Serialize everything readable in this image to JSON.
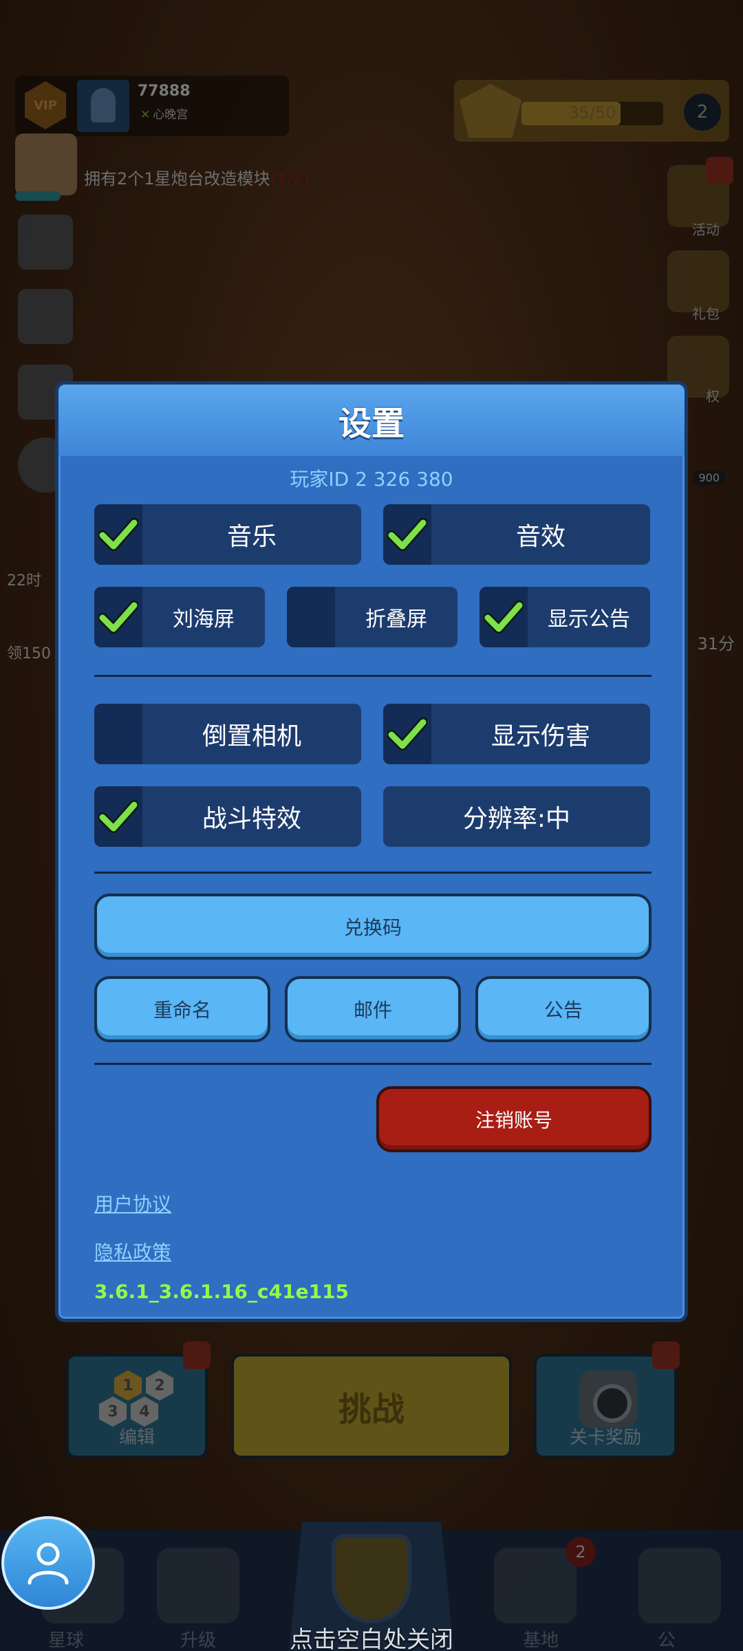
{
  "hud": {
    "vip_label": "VIP",
    "player_score": "77888",
    "player_rank": "心晚宫",
    "star_progress_text": "35/50",
    "star_progress_ratio": 0.7,
    "star_level": "2",
    "quest_text": "拥有2个1星炮台改造模块",
    "quest_progress": "(1/2)",
    "side_timer": "22时",
    "side_reward": "领150",
    "side_right_value": "31分",
    "side_900": "900",
    "right_labels": [
      "活动",
      "礼包",
      "权"
    ]
  },
  "bottom": {
    "edit_label": "编辑",
    "challenge_label": "挑战",
    "reward_label": "关卡奖励",
    "hex_numbers": [
      "1",
      "2",
      "3",
      "4"
    ],
    "nav_labels": [
      "星球",
      "升级",
      "基地",
      "公"
    ],
    "nav_badge": "2",
    "tap_close": "点击空白处关闭"
  },
  "settings": {
    "title": "设置",
    "player_id": "玩家ID 2 326 380",
    "options_row1": [
      {
        "label": "音乐",
        "checked": true
      },
      {
        "label": "音效",
        "checked": true
      }
    ],
    "options_row2": [
      {
        "label": "刘海屏",
        "checked": true
      },
      {
        "label": "折叠屏",
        "checked": false
      },
      {
        "label": "显示公告",
        "checked": true
      }
    ],
    "options_row3": [
      {
        "label": "倒置相机",
        "checked": false
      },
      {
        "label": "显示伤害",
        "checked": true
      }
    ],
    "options_row4": [
      {
        "label": "战斗特效",
        "checked": true
      }
    ],
    "resolution_label": "分辨率:中",
    "redeem_code_label": "兑换码",
    "rename_label": "重命名",
    "mail_label": "邮件",
    "announcement_label": "公告",
    "delete_account_label": "注销账号",
    "user_agreement_label": "用户协议",
    "privacy_policy_label": "隐私政策",
    "version": "3.6.1_3.6.1.16_c41e115"
  },
  "colors": {
    "dialog_bg": "#2f6ec0",
    "option_bg": "#1d3c6e",
    "check_green": "#7ee04a",
    "light_button": "#5ab6f5",
    "danger_button": "#a81e15",
    "version_green": "#8dff4a",
    "link_blue": "#8fd0ff"
  },
  "icons": {
    "check": "check-icon",
    "profile": "user-icon",
    "settings": "gear-icon"
  }
}
